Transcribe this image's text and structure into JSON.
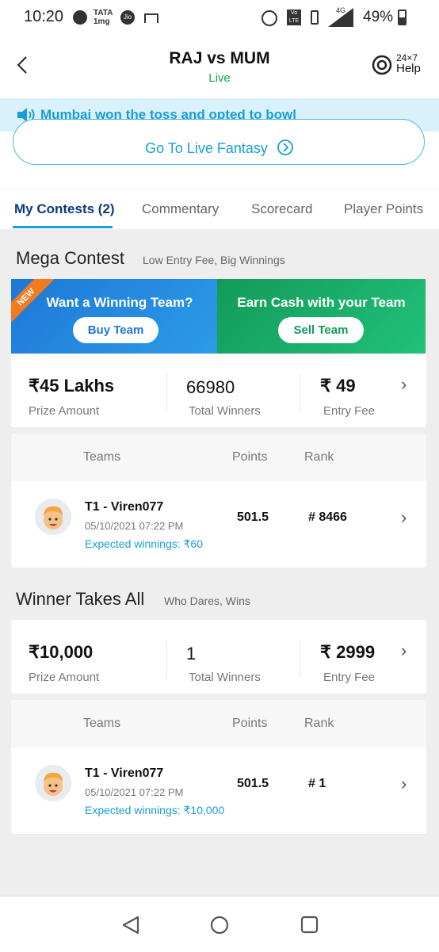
{
  "status_bar": {
    "time": "10:20",
    "battery": "49%",
    "network": "4G",
    "icons": [
      "chat-icon",
      "tata-1mg-icon",
      "jio-icon",
      "cast-icon",
      "data-saver-icon",
      "volte-icon",
      "vibrate-icon",
      "signal-icon",
      "battery-icon"
    ]
  },
  "header": {
    "title": "RAJ vs MUM",
    "status": "Live",
    "help_top": "24×7",
    "help_label": "Help"
  },
  "banner": {
    "toss_text": "Mumbai won the toss and opted to bowl",
    "live_fantasy_label": "Go To Live Fantasy"
  },
  "tabs": [
    {
      "label": "My Contests (2)",
      "active": true
    },
    {
      "label": "Commentary"
    },
    {
      "label": "Scorecard"
    },
    {
      "label": "Player Points"
    }
  ],
  "mega": {
    "title": "Mega Contest",
    "subtitle": "Low Entry Fee, Big Winnings",
    "promo_left": {
      "badge": "NEW",
      "text": "Want a Winning Team?",
      "button": "Buy Team"
    },
    "promo_right": {
      "text": "Earn Cash with your Team",
      "button": "Sell Team"
    },
    "prize_amount": "₹45 Lakhs",
    "prize_label": "Prize Amount",
    "winners": "66980",
    "winners_label": "Total Winners",
    "entry_fee": "₹ 49",
    "entry_label": "Entry Fee",
    "table_headers": {
      "teams": "Teams",
      "points": "Points",
      "rank": "Rank"
    },
    "team": {
      "name": "T1 - Viren077",
      "date": "05/10/2021 07:22 PM",
      "expected": "Expected winnings: ₹60",
      "points": "501.5",
      "rank": "# 8466"
    }
  },
  "wta": {
    "title": "Winner Takes All",
    "subtitle": "Who Dares, Wins",
    "prize_amount": "₹10,000",
    "prize_label": "Prize Amount",
    "winners": "1",
    "winners_label": "Total Winners",
    "entry_fee": "₹ 2999",
    "entry_label": "Entry Fee",
    "table_headers": {
      "teams": "Teams",
      "points": "Points",
      "rank": "Rank"
    },
    "team": {
      "name": "T1 - Viren077",
      "date": "05/10/2021 07:22 PM",
      "expected": "Expected winnings: ₹10,000",
      "points": "501.5",
      "rank": "# 1"
    }
  },
  "colors": {
    "accent": "#1a9ed6",
    "live_green": "#1aa04b",
    "new_orange": "#f47a20",
    "buy_blue": "#1e78d6",
    "sell_green": "#139a58"
  }
}
